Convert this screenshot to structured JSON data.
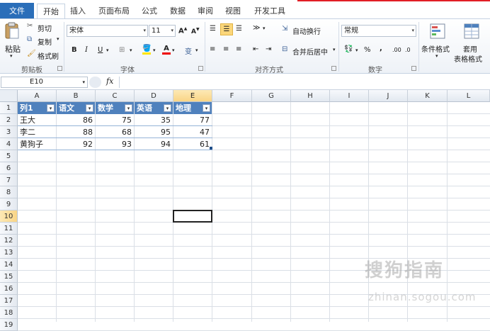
{
  "tabs": [
    "文件",
    "开始",
    "插入",
    "页面布局",
    "公式",
    "数据",
    "审阅",
    "视图",
    "开发工具"
  ],
  "clipboard": {
    "paste": "粘贴",
    "cut": "剪切",
    "copy": "复制",
    "format_painter": "格式刷",
    "label": "剪贴板"
  },
  "font": {
    "name": "宋体",
    "size": "11",
    "bold": "B",
    "italic": "I",
    "underline": "U",
    "label": "字体",
    "wen": "变",
    "color_a": "A"
  },
  "alignment": {
    "wrap_text": "自动换行",
    "merge_center": "合并后居中",
    "label": "对齐方式"
  },
  "number": {
    "format": "常规",
    "label": "数字",
    "percent": "%",
    "comma": ",",
    "dec_inc": ".00",
    "dec_dec": ".0"
  },
  "styles": {
    "conditional": "条件格式",
    "table_format_1": "套用",
    "table_format_2": "表格格式"
  },
  "formula_bar": {
    "name_box": "E10",
    "fx": "fx",
    "content": ""
  },
  "columns": [
    "A",
    "B",
    "C",
    "D",
    "E",
    "F",
    "G",
    "H",
    "I",
    "J",
    "K",
    "L"
  ],
  "rows": [
    "1",
    "2",
    "3",
    "4",
    "5",
    "6",
    "7",
    "8",
    "9",
    "10",
    "11",
    "12",
    "13",
    "14",
    "15",
    "16",
    "17",
    "18",
    "19"
  ],
  "table": {
    "headers": [
      "列1",
      "语文",
      "数学",
      "英语",
      "地理"
    ],
    "data": [
      [
        "王大",
        "86",
        "75",
        "35",
        "77"
      ],
      [
        "李二",
        "88",
        "68",
        "95",
        "47"
      ],
      [
        "黄狗子",
        "92",
        "93",
        "94",
        "61"
      ]
    ]
  },
  "selected_cell": "E10",
  "watermark": {
    "line1": "搜狗指南",
    "line2": "zhinan.sogou.com"
  },
  "colors": {
    "table_header": "#4f81bd",
    "file_tab": "#2a6eb9",
    "selection_header": "#f9d586"
  }
}
